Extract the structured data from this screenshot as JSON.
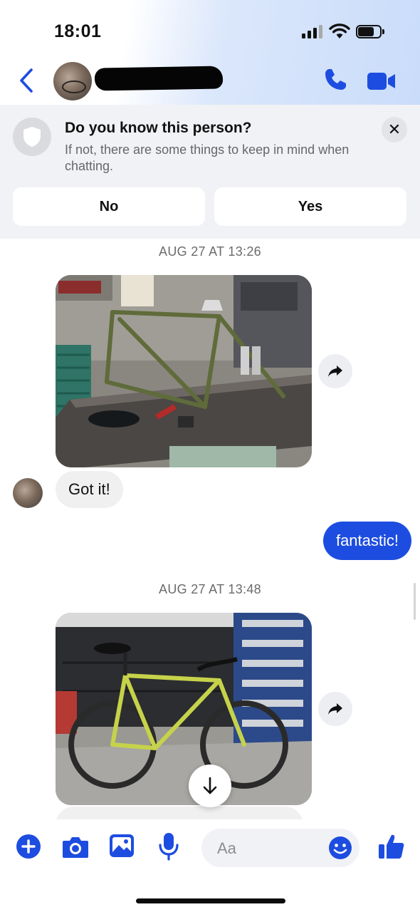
{
  "status_bar": {
    "time": "18:01",
    "signal_bars_filled": 3,
    "signal_bars_total": 4,
    "battery_level": 0.65
  },
  "header": {
    "back_icon": "chevron-left-icon",
    "call_icon": "phone-icon",
    "video_icon": "video-camera-icon",
    "accent_color": "#1d4de0"
  },
  "safety_banner": {
    "title": "Do you know this person?",
    "subtitle": "If not, there are some things to keep in mind when chatting.",
    "no_label": "No",
    "yes_label": "Yes",
    "close_label": "✕"
  },
  "chat": {
    "stamp_1": "AUG 27 AT 13:26",
    "msg_in_1": "Got it!",
    "msg_out_1": "fantastic!",
    "stamp_2": "AUG 27 AT 13:48"
  },
  "composer": {
    "placeholder": "Aa",
    "icons": [
      "plus-icon",
      "camera-icon",
      "image-icon",
      "microphone-icon",
      "emoji-icon",
      "thumbs-up-icon"
    ]
  }
}
